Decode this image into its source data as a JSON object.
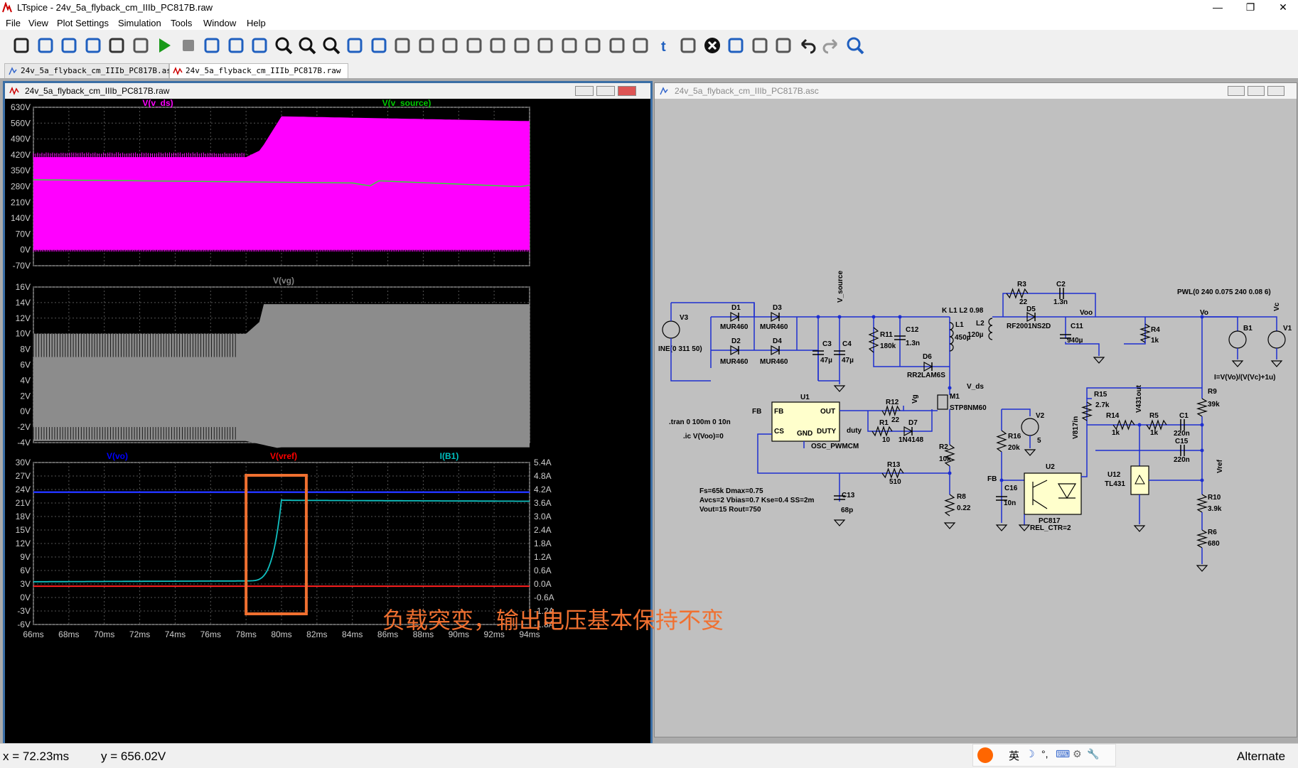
{
  "window": {
    "title": "LTspice - 24v_5a_flyback_cm_IIIb_PC817B.raw",
    "controls": [
      "—",
      "❐",
      "✕"
    ]
  },
  "menu": [
    "File",
    "View",
    "Plot Settings",
    "Simulation",
    "Tools",
    "Window",
    "Help"
  ],
  "toolbar_icons": [
    "control-panel",
    "new-schematic",
    "open",
    "save",
    "print",
    "print-setup",
    "run",
    "halt",
    "tile-vertical",
    "tile-horizontal",
    "cascade",
    "zoom-in",
    "zoom-out",
    "zoom-fit",
    "autorange",
    "view-wave",
    "wire",
    "ground",
    "label-net",
    "resistor",
    "capacitor",
    "inductor",
    "diode",
    "component",
    "move",
    "drag",
    "undo-redo",
    "text",
    "spice-directive",
    "delete",
    "duplicate",
    "rotate",
    "mirror",
    "undo",
    "redo",
    "find"
  ],
  "tabs": [
    {
      "label": "24v_5a_flyback_cm_IIIb_PC817B.asc",
      "active": false
    },
    {
      "label": "24v_5a_flyback_cm_IIIb_PC817B.raw",
      "active": true
    }
  ],
  "waveform_window": {
    "title": "24v_5a_flyback_cm_IIIb_PC817B.raw",
    "panes": [
      {
        "traces": [
          {
            "name": "V(v_ds)",
            "color": "#ff00ff"
          },
          {
            "name": "V(v_source)",
            "color": "#00cc00"
          }
        ],
        "y_ticks": [
          "630V",
          "560V",
          "490V",
          "420V",
          "350V",
          "280V",
          "210V",
          "140V",
          "70V",
          "0V",
          "-70V"
        ]
      },
      {
        "traces": [
          {
            "name": "V(vg)",
            "color": "#808080"
          }
        ],
        "y_ticks": [
          "16V",
          "14V",
          "12V",
          "10V",
          "8V",
          "6V",
          "4V",
          "2V",
          "0V",
          "-2V",
          "-4V"
        ]
      },
      {
        "traces": [
          {
            "name": "V(vo)",
            "color": "#0000ff"
          },
          {
            "name": "V(vref)",
            "color": "#ff0000"
          },
          {
            "name": "I(B1)",
            "color": "#00c0c0"
          }
        ],
        "y_ticks": [
          "30V",
          "27V",
          "24V",
          "21V",
          "18V",
          "15V",
          "12V",
          "9V",
          "6V",
          "3V",
          "0V",
          "-3V",
          "-6V"
        ],
        "y2_ticks": [
          "5.4A",
          "4.8A",
          "4.2A",
          "3.6A",
          "3.0A",
          "2.4A",
          "1.8A",
          "1.2A",
          "0.6A",
          "0.0A",
          "-0.6A",
          "-1.2A",
          "-1.8A"
        ]
      }
    ],
    "x_ticks": [
      "66ms",
      "68ms",
      "70ms",
      "72ms",
      "74ms",
      "76ms",
      "78ms",
      "80ms",
      "82ms",
      "84ms",
      "86ms",
      "88ms",
      "90ms",
      "92ms",
      "94ms"
    ],
    "annotation": "负载突变，输出电压基本保持不变",
    "annotation_color": "#f07030"
  },
  "schematic_window": {
    "title": "24v_5a_flyback_cm_IIIb_PC817B.asc",
    "labels": {
      "v3": "V3",
      "v3_val": "INE(0 311 50)",
      "d1": "D1",
      "d1_val": "MUR460",
      "d2": "D2",
      "d2_val": "MUR460",
      "d3": "D3",
      "d3_val": "MUR460",
      "d4": "D4",
      "d4_val": "MUR460",
      "c3": "C3",
      "c3_val": "47µ",
      "c4": "C4",
      "c4_val": "47µ",
      "v_source": "V_source",
      "r11": "R11",
      "r11_val": "180k",
      "c12": "C12",
      "c12_val": "1.3n",
      "d6": "D6",
      "d6_val": "RR2LAM6S",
      "k": "K L1 L2 0.98",
      "l1": "L1",
      "l1_val": "450µ",
      "l2": "L2",
      "l2_val": "120µ",
      "r3": "R3",
      "r3_val": "22",
      "c2": "C2",
      "c2_val": "1.3n",
      "d5": "D5",
      "d5_val": "RF2001NS2D",
      "voo": "Voo",
      "c11": "C11",
      "c11_val": "940µ",
      "r4": "R4",
      "r4_val": "1k",
      "vo": "Vo",
      "pwl": "PWL(0 240 0.075 240 0.08 6)",
      "b1": "B1",
      "v1": "V1",
      "vc": "Vc",
      "b1_expr": "I=V(Vo)/(V(Vc)+1u)",
      "v_ds": "V_ds",
      "m1": "M1",
      "m1_val": "STP8NM60",
      "u1": "U1",
      "fb": "FB",
      "out": "OUT",
      "cs": "CS",
      "gnd": "GND",
      "duty": "DUTY",
      "duty_net": "duty",
      "osc": "OSC_PWMCM",
      "r12": "R12",
      "r12_val": "22",
      "vg": "Vg",
      "r1": "R1",
      "r1_val": "10",
      "d7": "D7",
      "d7_val": "1N4148",
      "r2": "R2",
      "r2_val": "10k",
      "r13": "R13",
      "r13_val": "510",
      "r8": "R8",
      "r8_val": "0.22",
      "c13": "C13",
      "c13_val": "68p",
      "tran": ".tran 0 100m 0 10n",
      "ic": ".ic V(Voo)=0",
      "params1": "Fs=65k Dmax=0.75",
      "params2": "Avcs=2 Vbias=0.7 Kse=0.4 SS=2m",
      "params3": "Vout=15 Rout=750",
      "v2": "V2",
      "v2_val": "5",
      "r16": "R16",
      "r16_val": "20k",
      "fb2": "FB",
      "c16": "C16",
      "c16_val": "10n",
      "u2": "U2",
      "u2_val": "PC817",
      "u2_param": "REL_CTR=2",
      "r15": "R15",
      "r15_val": "2.7k",
      "v817in": "V817in",
      "r14": "R14",
      "r14_val": "1k",
      "v431out": "V431out",
      "r5": "R5",
      "r5_val": "1k",
      "c1": "C1",
      "c1_val": "220n",
      "c15": "C15",
      "c15_val": "220n",
      "u12": "U12",
      "u12_val": "TL431",
      "vref": "Vref",
      "r9": "R9",
      "r9_val": "39k",
      "r10": "R10",
      "r10_val": "3.9k",
      "r6": "R6",
      "r6_val": "680"
    }
  },
  "status": {
    "x": "x = 72.23ms",
    "y": "y = 656.02V",
    "right": "Alternate",
    "ime": [
      "英",
      "☽",
      "°,",
      "⌨",
      "⚙",
      "🔧"
    ]
  }
}
